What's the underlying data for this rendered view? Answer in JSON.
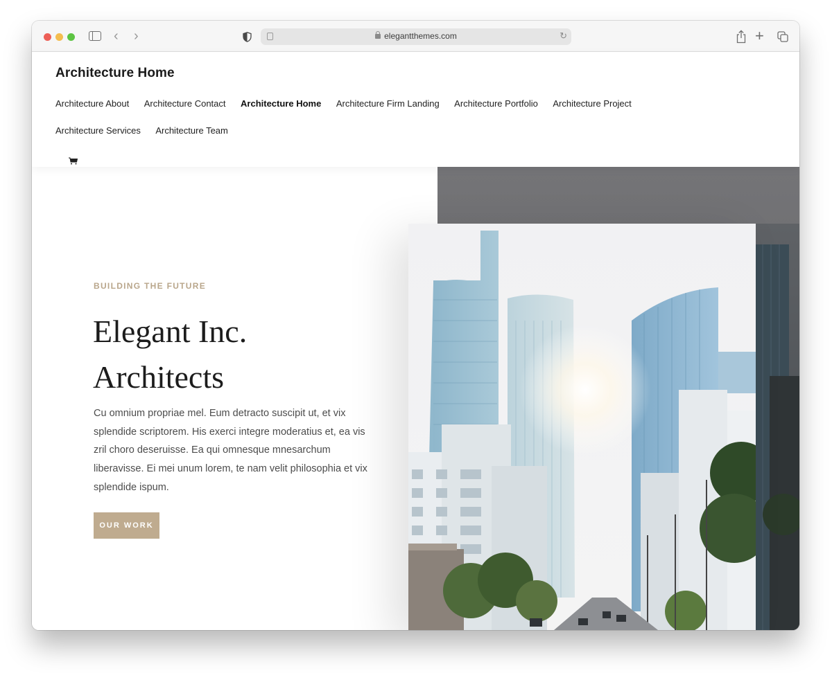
{
  "browser": {
    "url": "elegantthemes.com",
    "icons": {
      "close": "traffic-light-red",
      "minimize": "traffic-light-yellow",
      "zoom": "traffic-light-green",
      "sidebar": "sidebar-icon",
      "back": "chevron-left-icon",
      "forward": "chevron-right-icon",
      "privacy": "shield-icon",
      "reader": "reader-icon",
      "lock": "lock-icon",
      "reload": "reload-icon",
      "share": "share-icon",
      "new_tab": "plus-icon",
      "tabs": "tabs-overview-icon"
    },
    "glyphs": {
      "back": "‹",
      "forward": "›",
      "reload": "↻",
      "plus": "+"
    }
  },
  "site": {
    "title": "Architecture Home",
    "menu": [
      {
        "label": "Architecture About",
        "active": false
      },
      {
        "label": "Architecture Contact",
        "active": false
      },
      {
        "label": "Architecture Home",
        "active": true
      },
      {
        "label": "Architecture Firm Landing",
        "active": false
      },
      {
        "label": "Architecture Portfolio",
        "active": false
      },
      {
        "label": "Architecture Project",
        "active": false
      },
      {
        "label": "Architecture Services",
        "active": false
      },
      {
        "label": "Architecture Team",
        "active": false
      }
    ],
    "cart_icon": "cart-icon"
  },
  "hero": {
    "eyebrow": "BUILDING THE FUTURE",
    "headline_line1": "Elegant Inc.",
    "headline_line2": "Architects",
    "body": "Cu omnium propriae mel. Eum detracto suscipit ut, et vix splendide scriptorem. His exerci integre moderatius et, ea vis zril choro deseruisse. Ea qui omnesque mnesarchum liberavisse. Ei mei unum lorem, te nam velit philosophia et vix splendide ispum.",
    "cta_label": "OUR WORK",
    "image_alt": "City street with glass skyscrapers and sun flare"
  },
  "colors": {
    "accent": "#bfab8f",
    "eyebrow": "#b9a68b",
    "headline": "#1c1c1c",
    "body": "#4c4c4c",
    "panel": "#6e6e71"
  }
}
